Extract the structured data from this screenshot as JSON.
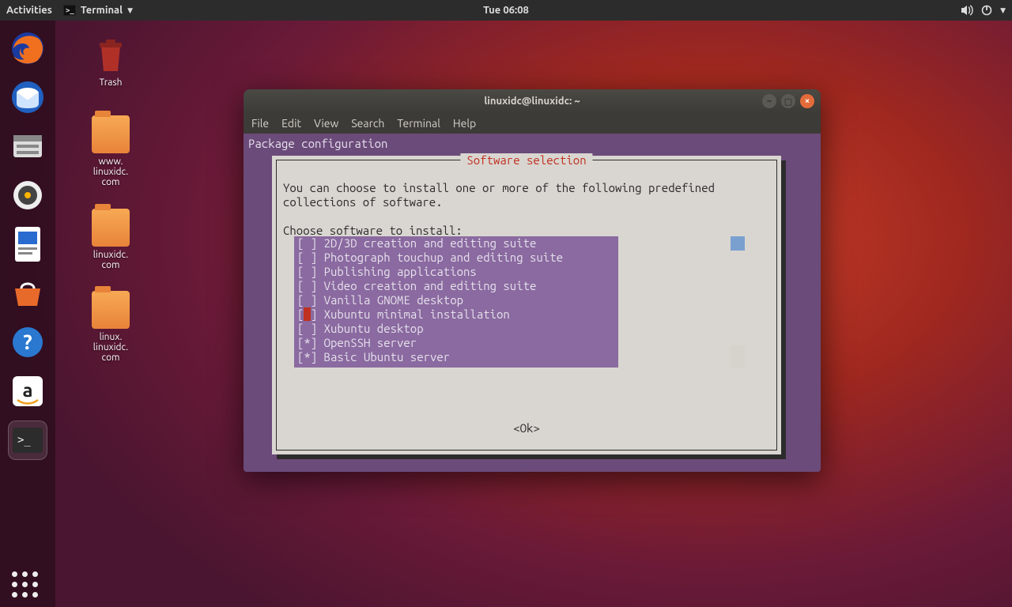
{
  "topbar": {
    "activities": "Activities",
    "app_menu": "Terminal",
    "clock": "Tue 06:08"
  },
  "desktop_icons": {
    "trash": "Trash",
    "folder1": "www.\nlinuxidc.\ncom",
    "folder2": "linuxidc.\ncom",
    "folder3": "linux.\nlinuxidc.\ncom"
  },
  "window": {
    "title": "linuxidc@linuxidc: ~",
    "menu": [
      "File",
      "Edit",
      "View",
      "Search",
      "Terminal",
      "Help"
    ]
  },
  "term": {
    "header": "Package configuration",
    "box_title": "Software selection",
    "desc1": "You can choose to install one or more of the following predefined",
    "desc2": "collections of software.",
    "prompt": "Choose software to install:",
    "options": [
      {
        "mark": " ",
        "label": "2D/3D creation and editing suite",
        "cursor": false
      },
      {
        "mark": " ",
        "label": "Photograph touchup and editing suite",
        "cursor": false
      },
      {
        "mark": " ",
        "label": "Publishing applications",
        "cursor": false
      },
      {
        "mark": " ",
        "label": "Video creation and editing suite",
        "cursor": false
      },
      {
        "mark": " ",
        "label": "Vanilla GNOME desktop",
        "cursor": false
      },
      {
        "mark": " ",
        "label": "Xubuntu minimal installation",
        "cursor": true
      },
      {
        "mark": " ",
        "label": "Xubuntu desktop",
        "cursor": false
      },
      {
        "mark": "*",
        "label": "OpenSSH server",
        "cursor": false
      },
      {
        "mark": "*",
        "label": "Basic Ubuntu server",
        "cursor": false
      }
    ],
    "ok": "<Ok>"
  }
}
